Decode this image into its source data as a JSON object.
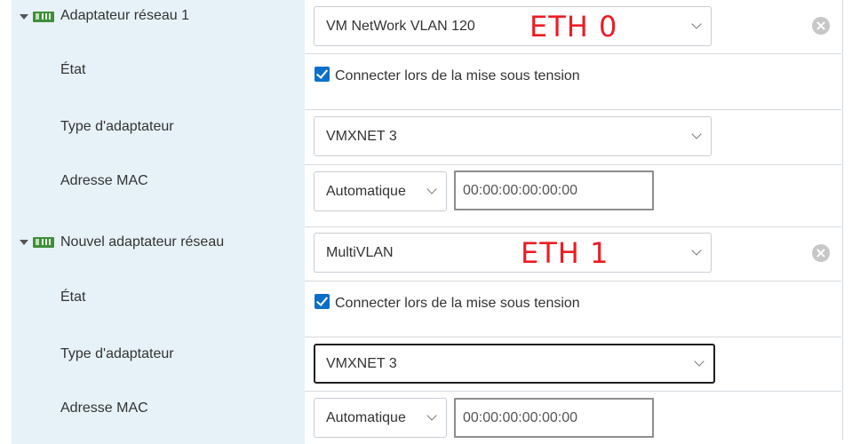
{
  "adapters": [
    {
      "title": "Adaptateur réseau 1",
      "network": "VM NetWork VLAN 120",
      "annotation": "ETH 0",
      "state_label": "État",
      "state_text": "Connecter lors de la mise sous tension",
      "state_checked": true,
      "type_label": "Type d'adaptateur",
      "type_value": "VMXNET 3",
      "mac_label": "Adresse MAC",
      "mac_mode": "Automatique",
      "mac_value": "00:00:00:00:00:00"
    },
    {
      "title": "Nouvel adaptateur réseau",
      "network": "MultiVLAN",
      "annotation": "ETH 1",
      "state_label": "État",
      "state_text": "Connecter lors de la mise sous tension",
      "state_checked": true,
      "type_label": "Type d'adaptateur",
      "type_value": "VMXNET 3",
      "mac_label": "Adresse MAC",
      "mac_mode": "Automatique",
      "mac_value": "00:00:00:00:00:00"
    }
  ],
  "colors": {
    "label_bg": "#e7f1f8",
    "checkbox": "#0b6fc9",
    "annotation": "#ee1c24",
    "nic_icon": "#3f8f3a"
  }
}
